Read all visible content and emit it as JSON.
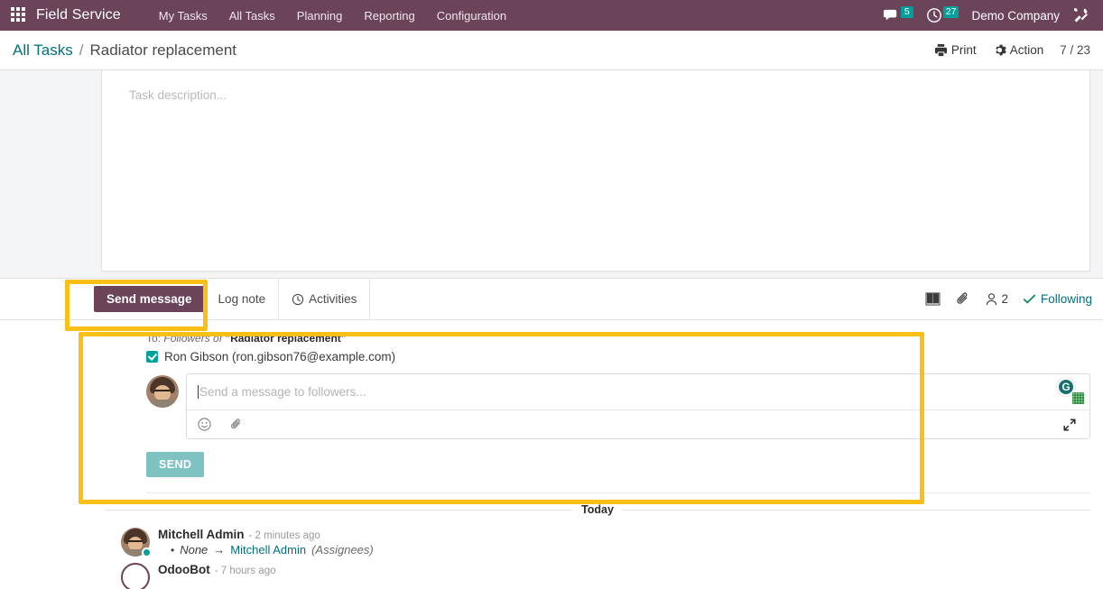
{
  "navbar": {
    "apps_icon": "apps-grid-icon",
    "brand": "Field Service",
    "menu": [
      {
        "label": "My Tasks"
      },
      {
        "label": "All Tasks"
      },
      {
        "label": "Planning"
      },
      {
        "label": "Reporting"
      },
      {
        "label": "Configuration"
      }
    ],
    "messages_icon": "chat-bubble-icon",
    "messages_count": "5",
    "activities_icon": "clock-icon",
    "activities_count": "27",
    "company": "Demo Company",
    "debug_icon": "tools-icon"
  },
  "breadcrumb": {
    "parent": "All Tasks",
    "separator": "/",
    "current": "Radiator replacement",
    "print_label": "Print",
    "print_icon": "printer-icon",
    "action_label": "Action",
    "action_icon": "gear-icon",
    "pager": "7 / 23"
  },
  "sheet": {
    "description_placeholder": "Task description..."
  },
  "chatter": {
    "tabs": [
      {
        "label": "Send message",
        "active": true,
        "icon": ""
      },
      {
        "label": "Log note",
        "active": false,
        "icon": ""
      },
      {
        "label": "Activities",
        "active": false,
        "icon": "clock-icon"
      }
    ],
    "tools": {
      "log_icon": "book-icon",
      "attachment_icon": "paperclip-icon",
      "followers_icon": "user-icon",
      "followers_count": "2",
      "following_icon": "check-icon",
      "following_label": "Following"
    },
    "composer": {
      "to_prefix": "To:",
      "to_scope": "Followers of",
      "to_record": "\"Radiator replacement\"",
      "recipient_checked": true,
      "recipient": "Ron Gibson (ron.gibson76@example.com)",
      "avatar": "user-avatar",
      "placeholder": "Send a message to followers...",
      "emoji_icon": "smiley-icon",
      "attach_icon": "paperclip-icon",
      "expand_icon": "expand-arrows-icon",
      "grammarly_icon": "grammarly-icon",
      "grammarly_letter": "G",
      "send_label": "SEND"
    },
    "thread": {
      "day_separator": "Today",
      "messages": [
        {
          "author": "Mitchell Admin",
          "time": "- 2 minutes ago",
          "avatar": "user-avatar",
          "online": true,
          "tracking": {
            "bullet": "•",
            "old_value": "None",
            "arrow": "→",
            "new_value": "Mitchell Admin",
            "field": "(Assignees)"
          }
        },
        {
          "author": "OdooBot",
          "time": "- 7 hours ago",
          "avatar": "bot-avatar",
          "online": false,
          "tracking": null
        }
      ]
    }
  },
  "colors": {
    "brand_purple": "#6b4459",
    "teal": "#00a09d",
    "link_teal": "#00707f",
    "highlight_yellow": "#fbc017",
    "send_button": "#7fc2c2"
  }
}
